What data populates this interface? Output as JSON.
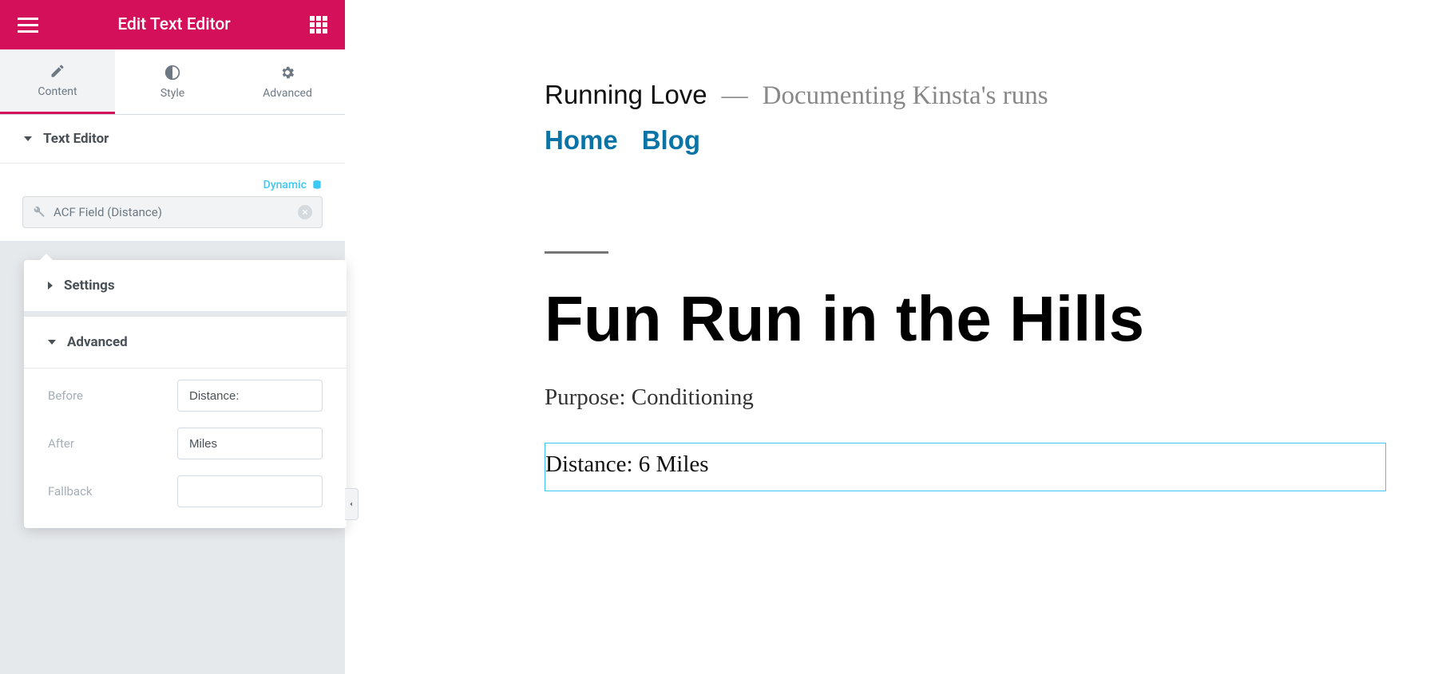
{
  "sidebar": {
    "title": "Edit Text Editor",
    "tabs": {
      "content": "Content",
      "style": "Style",
      "advanced": "Advanced"
    },
    "section_text_editor": "Text Editor",
    "dynamic_label": "Dynamic",
    "field_tag": "ACF Field (Distance)",
    "popover": {
      "settings": "Settings",
      "advanced": "Advanced",
      "before_label": "Before",
      "before_value": "Distance:",
      "after_label": "After",
      "after_value": "Miles",
      "fallback_label": "Fallback",
      "fallback_value": ""
    }
  },
  "preview": {
    "site_title": "Running Love",
    "site_dash": "—",
    "site_tagline": "Documenting Kinsta's runs",
    "nav": {
      "home": "Home",
      "blog": "Blog"
    },
    "post_title": "Fun Run in the Hills",
    "purpose": "Purpose: Conditioning",
    "distance": "Distance: 6 Miles"
  }
}
